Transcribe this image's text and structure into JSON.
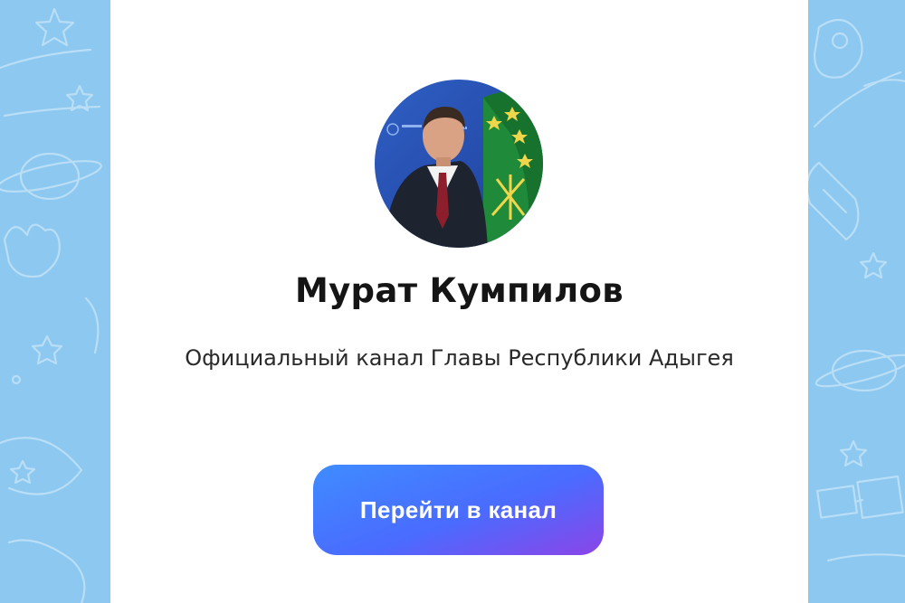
{
  "channel": {
    "name": "Мурат Кумпилов",
    "description": "Официальный канал Главы Республики Адыгея"
  },
  "actions": {
    "open_channel_label": "Перейти в канал"
  },
  "colors": {
    "background": "#8cc8ef",
    "card": "#ffffff",
    "button_start": "#3f8cff",
    "button_end": "#8b45e8"
  },
  "icons": {
    "background_doodles": [
      "star-icon",
      "planet-icon",
      "rocket-icon",
      "satellite-icon",
      "comet-icon",
      "hand-icon"
    ]
  }
}
